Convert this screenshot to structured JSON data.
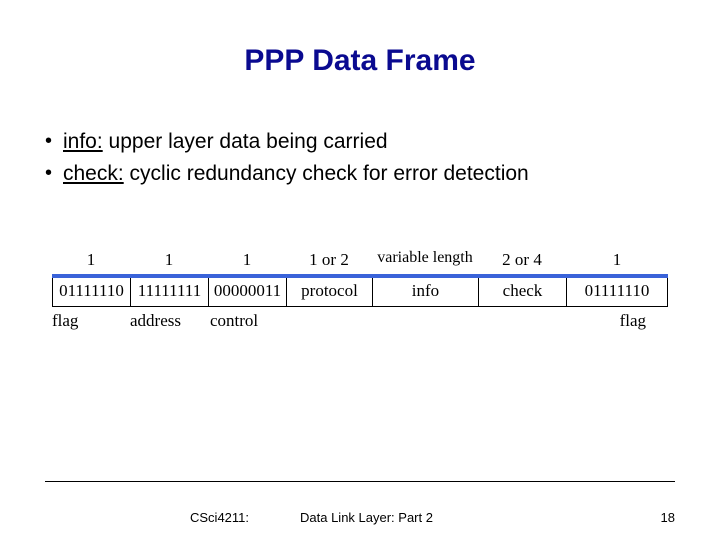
{
  "title": "PPP Data Frame",
  "bullets": [
    {
      "label": "info:",
      "text": " upper layer data being carried"
    },
    {
      "label": "check:",
      "text": "  cyclic redundancy check for error detection"
    }
  ],
  "frame": {
    "sizes": [
      "1",
      "1",
      "1",
      "1 or 2",
      "variable length",
      "2 or 4",
      "1"
    ],
    "cells": [
      "01111110",
      "11111111",
      "00000011",
      "protocol",
      "info",
      "check",
      "01111110"
    ],
    "labels": [
      "flag",
      "address",
      "control",
      "",
      "",
      "",
      "flag"
    ]
  },
  "footer": {
    "course": "CSci4211:",
    "topic": "Data Link Layer: Part 2",
    "page": "18"
  }
}
